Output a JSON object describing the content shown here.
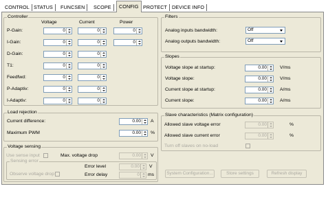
{
  "tabs": [
    "CONTROL",
    "STATUS",
    "FUNCSEN",
    "SCOPE",
    "CONFIG",
    "PROTECT",
    "DEVICE INFO"
  ],
  "controller": {
    "title": "Controller",
    "col_voltage": "Voltage",
    "col_current": "Current",
    "col_power": "Power",
    "rows": [
      "P-Gain:",
      "I-Gain:",
      "D-Gain:",
      "T1:",
      "Feedfwd:",
      "P-Adaptiv:",
      "I-Adaptiv:"
    ],
    "value": "0"
  },
  "filters": {
    "title": "Filters",
    "analog_in_label": "Analog inputs bandwidth:",
    "analog_in_value": "Off",
    "analog_out_label": "Analog outputs bandwidth:",
    "analog_out_value": "Off"
  },
  "slopes": {
    "title": "Slopes",
    "rows": [
      {
        "label": "Voltage slope at startup:",
        "value": "0.00",
        "unit": "V/ms"
      },
      {
        "label": "Voltage slope:",
        "value": "0.00",
        "unit": "V/ms"
      },
      {
        "label": "Current slope at startup:",
        "value": "0.00",
        "unit": "A/ms"
      },
      {
        "label": "Current slope:",
        "value": "0.00",
        "unit": "A/ms"
      }
    ]
  },
  "load_rejection": {
    "title": "Load rejection",
    "current_diff_label": "Current difference:",
    "current_diff_value": "0.00",
    "current_diff_unit": "A",
    "max_pwm_label": "Maximum PWM",
    "max_pwm_value": "0.00",
    "max_pwm_unit": "%"
  },
  "slave": {
    "title": "Slave characteristics (Matrix configuration)",
    "voltage_error_label": "Allowed slave voltage error",
    "voltage_error_value": "0.00",
    "voltage_error_unit": "%",
    "current_error_label": "Allowed slave current error",
    "current_error_value": "0.00",
    "current_error_unit": "%",
    "turn_off_label": "Turn off slaves on no-load"
  },
  "voltage_sensing": {
    "title": "Voltage sensing",
    "use_sense_label": "Use sense input",
    "max_drop_label": "Max. voltage drop",
    "max_drop_value": "0.00",
    "max_drop_unit": "V",
    "sensing_error_title": "Sensing error",
    "observe_label": "Observe voltage drop",
    "error_level_label": "Error level",
    "error_level_value": "0.00",
    "error_level_unit": "V",
    "error_delay_label": "Error delay",
    "error_delay_value": "0",
    "error_delay_unit": "ms"
  },
  "buttons": {
    "system_config": "System Configuration...",
    "store_settings": "Store settings",
    "refresh_display": "Refresh display"
  }
}
